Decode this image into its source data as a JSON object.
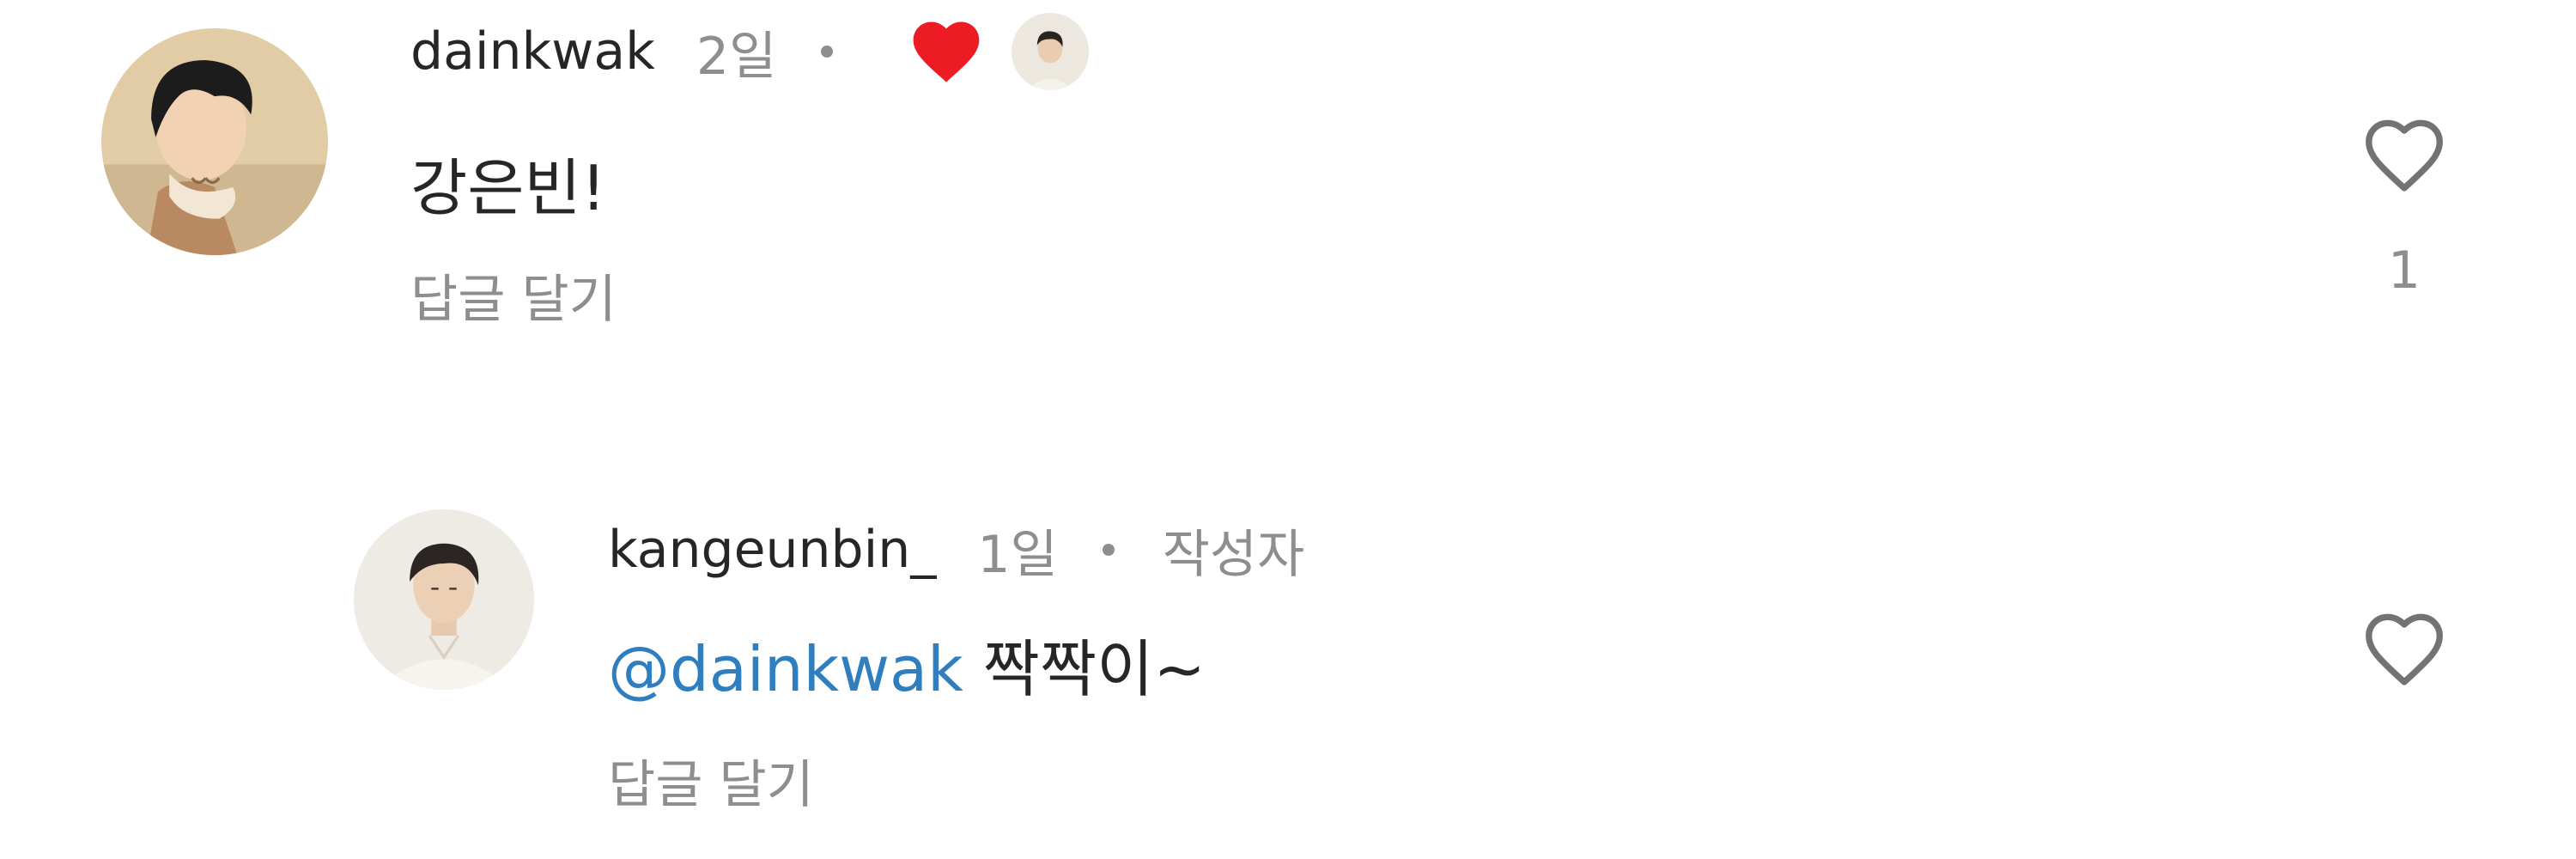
{
  "comments": [
    {
      "username": "dainkwak",
      "time": "2일",
      "text": "강은빈!",
      "reply_label": "답글 달기",
      "like_count": "1",
      "liked_by_author": true
    },
    {
      "username": "kangeunbin_",
      "time": "1일",
      "author_tag": "작성자",
      "mention": "@dainkwak",
      "text": " 짝짝이~",
      "reply_label": "답글 달기"
    }
  ],
  "colors": {
    "text_primary": "#262626",
    "text_secondary": "#8e8e8e",
    "mention": "#2f7fc0",
    "liked_heart": "#ed1c24"
  },
  "icons": {
    "like": "heart-outline-icon",
    "author_liked": "heart-filled-icon"
  }
}
